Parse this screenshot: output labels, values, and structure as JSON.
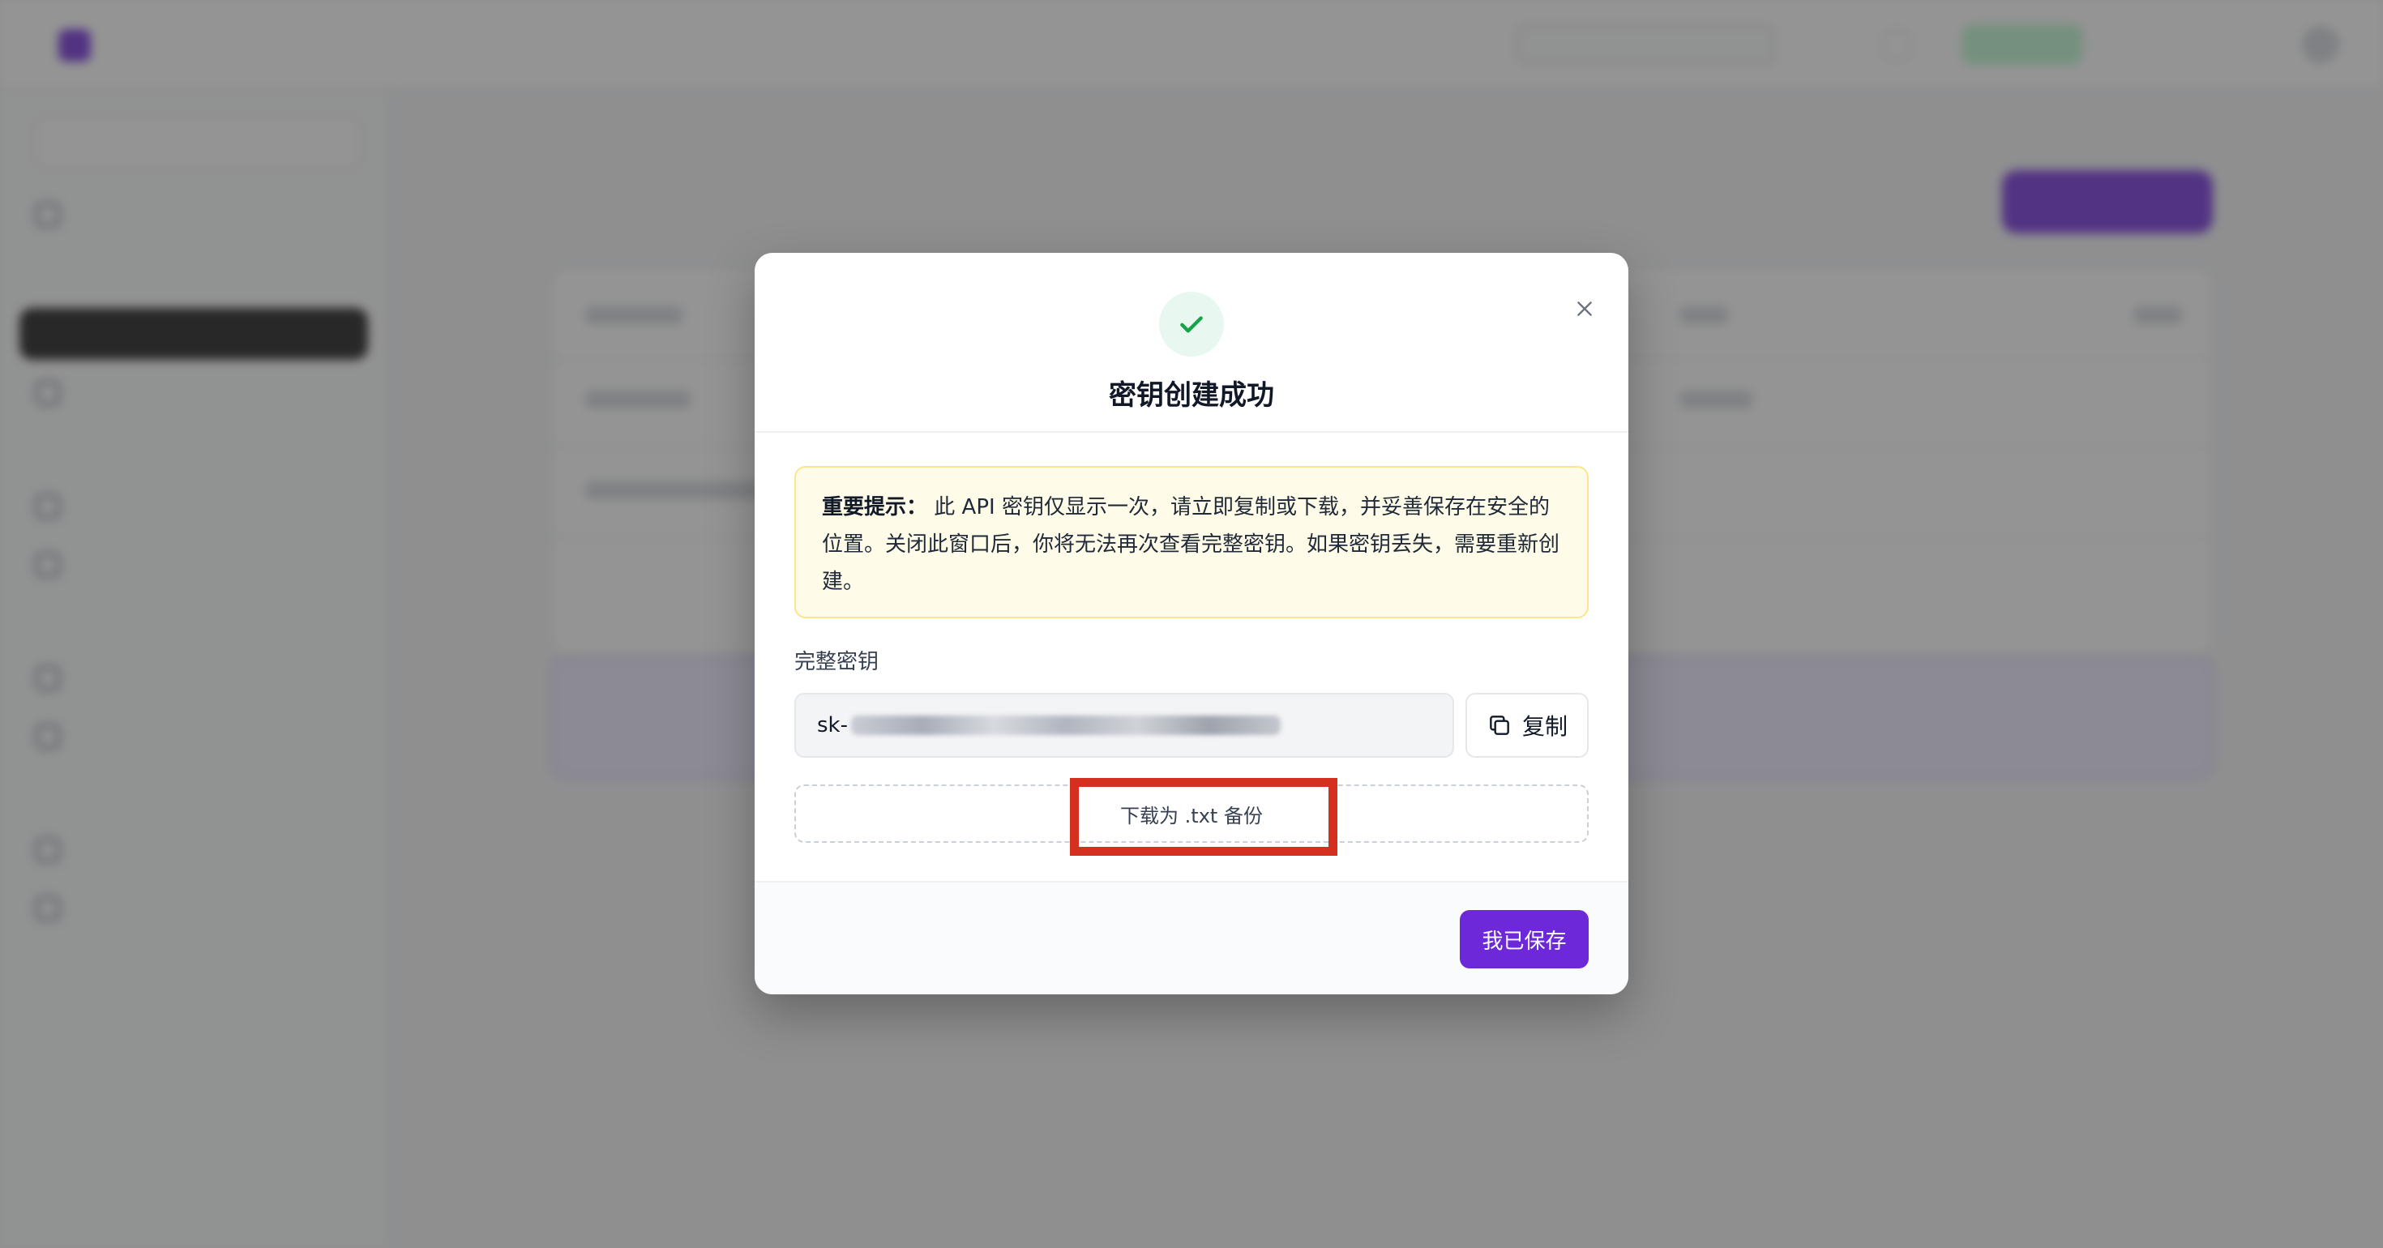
{
  "modal": {
    "title": "密钥创建成功",
    "warning_label": "重要提示：",
    "warning_text": "此 API 密钥仅显示一次，请立即复制或下载，并妥善保存在安全的位置。关闭此窗口后，你将无法再次查看完整密钥。如果密钥丢失，需要重新创建。",
    "key_label": "完整密钥",
    "key_value_visible": "sk-",
    "copy_label": "复制",
    "download_label": "下载为 .txt 备份",
    "confirm_label": "我已保存"
  },
  "colors": {
    "primary": "#6d28d9",
    "success": "#16a34a",
    "warning_bg": "#fefce8",
    "warning_border": "#fde68a",
    "highlight": "#d5301f"
  },
  "icons": {
    "success": "check-icon",
    "close": "close-icon",
    "copy": "copy-icon"
  }
}
